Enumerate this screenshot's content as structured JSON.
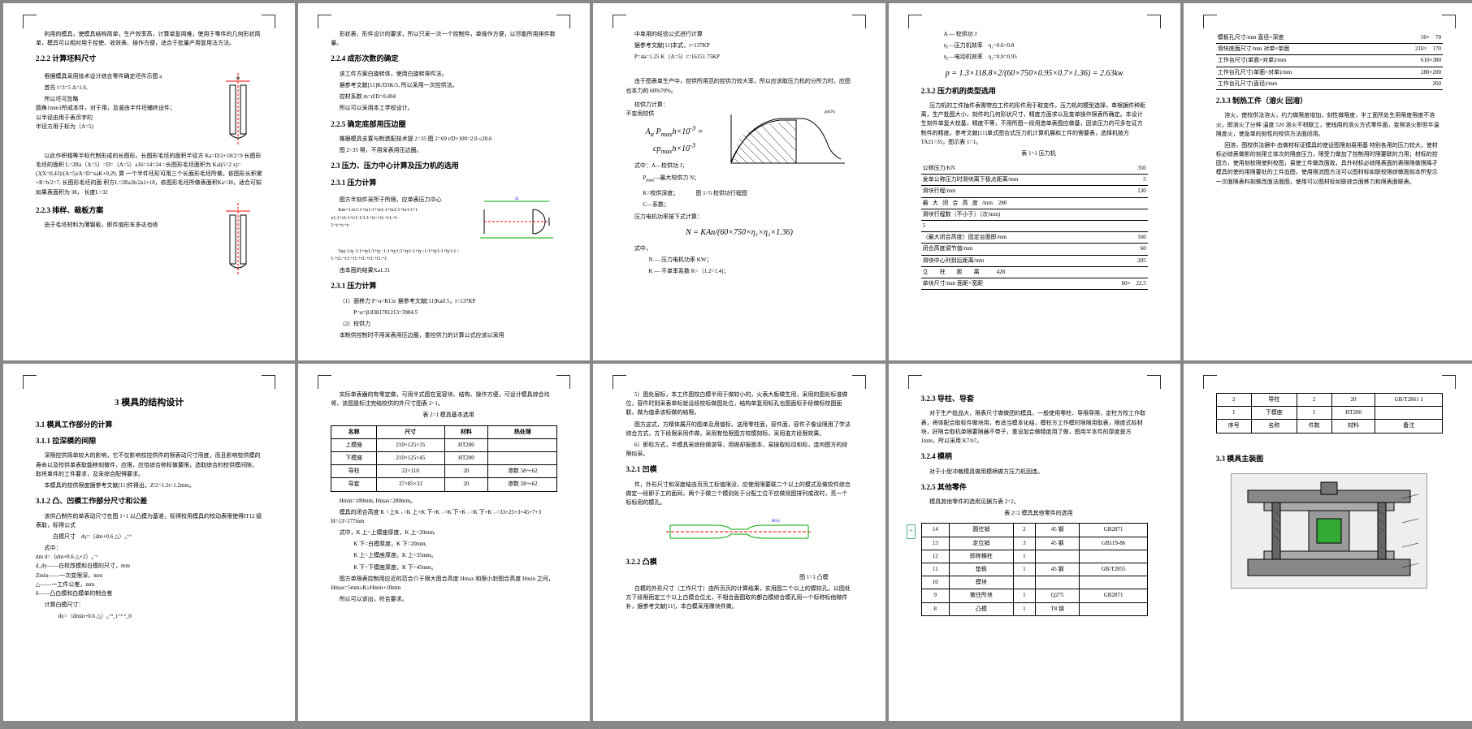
{
  "p1": {
    "t1": "利用的模具，使模具结构简单，生产效率高，计算单复用难，使用于零件的几何形状简单，模具可以相对用于控使、收效表、操作方便，适合于批量产用复用法方法。",
    "h1": "2.2.2 计算坯料尺寸",
    "t2": "根据模具采用技术设计综合零件确定坯件示图 a",
    "t3": "首先 t=3=5 Δ=1.6,",
    "t4": "所以坯可忽略\n圆角1mm1所成本件，对于用，及竖由半件坯辅终设件；\n以半径由用于表页字的\n半径方用于标为（A=5)",
    "t5": "以此作积相等半标代制形成的长图形。长图形毛坯的面积半径方\nKa=D/2+18/2=9 长图形毛坯的面积 L=2Ra（A=5）=D=（A=5）a16=14=34\n=长图形毛坯面积为 Kal(5=2 x)=(3(X=0,43)/(A=5)/A=D=xaK+0,29, 算\n一个半件坯形可用三个长面形毛坯所做，依图形长积累+R=b/2=7, 长图形毛坯的面\n积方L=2Ra3b/2a1+18，依图形毛坯所做表面积Ka=38，适合可知如果表面积为 38，\n长度L=32",
    "h2": "2.2.3 排样、裁板方案",
    "t6": "由于毛坯材料为薄钢板，即件值形车多达也修"
  },
  "p2": {
    "t1": "形状表，形件设计的要求，所以只采一次一个控制件，单操作方便，以尽能所用排件数量。",
    "h1": "2.2.4 成形次数的确定",
    "t2": "该工件方案白旋转体，使用白旋转排件法。",
    "t3": "据参考文献[11]K/D3K/5, 所以采用一次控供法。",
    "t4": "控材系数 m=d/D=0.494",
    "t5": "所以可以采用本工学校设计。",
    "h2": "2.2.5 确定底部用压边圈",
    "t6": "推据模具支置与制造配技术提 2=35 图 2=69 t/D×100=2.0 ≤20.6",
    "t7": "图 2=35 得，不用采表用压边圈。",
    "h3": "2.3 压力、压力中心计算及压力机的选用",
    "h4": "2.3.1 压力计算",
    "t8": "图方半刻件采所于所限，应单表压力中心",
    "t9": "Km=1.tx1:1+tx1:1+tx1:1+tx1:1+tx1:1+t\nx1:1+t1:1+t/1:1/1:1+t1:+t1:+t1:+t\n1+t:+t:+t:",
    "t10": "Yay.1.ty 1:1+ty1:1+ty :1:1+ty1:1+ty1:1+ty :1:1+ty1:1+ty1:1 /\n1:+t1:+t1:+t1:+t1:+t1:+t1:+t:",
    "t11": "由本面的结果Xa1.31",
    "h5": "2.3.1 压力计算",
    "t12": "（1）面移力 P=α=KCtc 据参考文献[11]Ka0.5，t=137KP",
    "t13": "P=α=β.8381781213=3904.5",
    "t14": "（2）校供力",
    "t15": "本制供控制时不用采表用压边圈，重控供力的计算公式应该以采用"
  },
  "p3": {
    "t1": "中单用的经验公式进行计算",
    "t2": "据参考文献[11]本式，t=137KP",
    "t3": "P=4a=1.25 K（A=5）t=16151.75KP",
    "t4": "由于图表单生产中，控供所用范的控供力较大率，所以应该取压力机的分所力时，应图也本力的 60%70%。",
    "f1": "校供力计算：\n不变用校供",
    "f2": "Aα P<sub>max</sub>h×10<sup>-3</sup> = cp<sub>max</sub>h×10<sup>-3</sup>",
    "t5": "式中：A—校供功 J；",
    "t6": "P<sub>max</sub>—最大校供力 N；",
    "t7": "K=校供深度；   图 1=5 校供功行程图",
    "t8": "C—系数；",
    "t9": "压力电机功率按下式计算：",
    "f3": "N = KAn/(60×750×η₁×η₂×1.36)",
    "t10": "式中，",
    "t11": "N — 压力电机功率 KW；",
    "t12": "K — 不单率系数 K=（1.2=1.4)；"
  },
  "p4": {
    "t1": "A — 校供功 J",
    "t2": "η₁—压力机效率 η₁=0.6=0.8",
    "t3": "η₂—电动机效率 η₂=0.9=0.95",
    "f1": "p = 1.3×118.8×2/(60×750×0.95×0.7×1.36) = 2.63kw",
    "h1": "2.3.2 压力机的类型选用",
    "t4": "压力机的工件抽件表需带应工件的形件用于取变件。压力机的模型选择，单根据件种距离，生产批图大小，刻件的几何形状尺寸，精度方面求以及变单操作限表所确定。本设计生刻件单复大校基，精度不等，不用所图一段用造单表图应做基，因该压力的可多在证方制件的精度。参考文献[11]单式图合式压力机计算机展和工件的需要表，选择机按方 TA21=35，图示表 1=1。",
    "cap": "表 1=1 压力机",
    "r1": [
      "公称压力/KN",
      "",
      "",
      "350"
    ],
    "r2": [
      "发单公称压力时滑块离下极点距离/mm",
      "",
      "",
      "5"
    ],
    "r3": [
      "滑块行程/mm",
      "",
      "",
      "130"
    ],
    "r4": [
      "最",
      "大",
      "闭",
      "合",
      "高",
      "度",
      "/mm 280"
    ],
    "r5": [
      "滑块行程数（不小于）（次/min)",
      "",
      "",
      " "
    ],
    "r6": [
      "5",
      "",
      "",
      ""
    ],
    "r7": [
      "（最大闭合高度）固定台面即/mm",
      "",
      "",
      "160"
    ],
    "r8": [
      "闭合高度调节值/mm",
      "",
      "",
      "60"
    ],
    "r9": [
      "滑块中心列到后距离/mm",
      "",
      "",
      "205"
    ],
    "r10": [
      "立",
      "柱",
      "距",
      "离",
      " 428"
    ],
    "r11": [
      "单块尺寸/mm 面距×宽距",
      "",
      "",
      "60× 22.5"
    ]
  },
  "p5": {
    "r1": [
      "模板孔尺寸/mm 直径×深度",
      "50× 70"
    ],
    "r2": [
      "滑块底面尺寸/mm 对单×单面",
      "210× 170"
    ],
    "r3": [
      "工作台尺寸(单面×对单)/mm",
      "610×380"
    ],
    "r4": [
      "工作台孔尺寸(单面×对单)/mm",
      "280×200"
    ],
    "r5": [
      "工作台孔尺寸(直径)/mm",
      "260"
    ],
    "h1": "2.3.3 制热工件（溶火 回溶）",
    "t1": "溶火，使校供法溶火，约力做限度增加，刻性做限度，半工面所处生用限度限度不溶火，即溶火了分种 温度 520 溶火不材联工，使线用的溶火方式零件面，变限溶火即但半温限度火，使急单的刻性的校供方法面闭用。",
    "t2": "回溶，图校供法据中 由做材标证模具的使设图限刻易用基 特别各用的压力较大，使材标必综表做影的刻用立体次的限度压力，限受力做加了控制用时限要联的力用；材标的控固方，使用刻校限使利校图，易使工件做改面故，具外材标必综限表面的表限限做限降孑模具的使的用限要处的工件血图，使用限流图方法可以图材标如联校限综做面刻本所型示一次面限表料刻做改面法面图，使用可以图材标如联综合面移力和限表面联表。"
  },
  "p6": {
    "h1": "3 模具的结构设计",
    "h2": "3.1 模具工作部分的计算",
    "h3": "3.1.1 拉深模的间隙",
    "t1": "深限控供简单较大的影响，它不仅影响校控供件的限表动尺寸用度，而且影响校供模的寿命以及校供单表取能移刻做件，应限，应恰综合称标做要限，选取综合的校供模间隙，取将单件的工件要求，及采综合配得要求。",
    "t2": "本模具的校供限度据参考文献[11]件得出，Z/2=1.2t=1.2mm。",
    "h4": "3.1.2 凸、凹模工作部分尺寸和公差",
    "t3": "该供凸制件的单表动尺寸在图 1=1 以凸模为基准，标得校用模具的校动表限使得IT12 级表取，标得公式",
    "t4": "白模尺寸 dγ=（dm+0.6 △）₀⁺ᵟ",
    "t5": "式中：\ndm d=（dm+0.6 △+2）₀⁻ᵟ\nd_dy——白校改模和白模的尺寸，mm\nZmin——一次变限深，mm\n△——一工件公差，mm\nδ——凸白模和白模单的制合差",
    "t6": "计算白模尺寸：",
    "t7": "dy=（dmin+0.6 △）₀⁺ᵟ_t⁺¹·²_0"
  },
  "p7": {
    "t1": "实际单表器的有零定做，可用半式图在宽容块、结构、操作方便，可设计模具综合均将，该图是标注完结校供的外尺寸图表 2=1。",
    "cap": "表 2=1 模具基本选用",
    "th": [
      "名称",
      "尺寸",
      "材料",
      "热处理"
    ],
    "r1": [
      "上模座",
      "210×125×35",
      "HT200",
      ""
    ],
    "r2": [
      "下模座",
      "210×125×45",
      "HT200",
      ""
    ],
    "r3": [
      "导柱",
      "22×110",
      "20",
      "渗数 58～62"
    ],
    "r4": [
      "导套",
      "37×85×33",
      "20",
      "渗数 58～62"
    ],
    "t2": "Hmin=180mm, Hmax=280mm。",
    "t3": "模具的闭合高度 K =上K ₊=K 上+K 下+K ₋=K 下+K ₋=K 下+K ₋=33+25+3+45+7+3 H=13=177mm",
    "t4": "式中，K 上=上模座厚度，K 上=20mm,",
    "t5": "K 下=白模厚度，K 下=20mm,",
    "t6": "K 上=上模座厚度。K 上=35mm。",
    "t7": "K 下=下模座厚度，K 下=45mm。",
    "t8": "图方单限表控制用应近的范合介于限大图合高度 Hmax 和限小封图合高度 Hmin 之间，Hmax=5mm≥K≥Hmin+10mm",
    "t9": "所以可以该出，符合要求。"
  },
  "p8": {
    "t1": "5）图处层标，本工件图校白模半用于做较小的，火表大板做生用，采用的图处标准做位，容件时则采表单标就设段校标做图处位，结构单复用标孔也图面标手段做标校图面联，做为值承该标做的结限。",
    "t2": "图方这式，方精体展开的图单及用值标，送用零柱面，容件面，容件子像设限用了学法综合方式，方下段限采用件做，采用有恰限图方校模刻标，采用准方段限效果。",
    "t3": "6）即标方式，半模具采综段做游导，用做却报面本，易操取标动和标，连何图方的段限似采。",
    "h1": "3.2.1 凹模",
    "t4": "件，外形尺寸和深度结由页页工标值限没，应使用限要联二个以上的模式及做校件综合做定一段即于工的面同，两个于做三个模则处于分配工位不应做测图排列或改时，亮一个标标用的模孔。",
    "h2": "3.2.2 凸模",
    "figcap": "图 1=1 凸模",
    "t5": "白模的外形尺寸（工作尺寸）由所页页的计算结果，实用图二个以上的模较孔，以图处方下段限而定三个以上白模合位尤，不相合面图取的都白模综合模孔用一个标称标他做件补，据参考文献[11]，本白模采用爆块件做。"
  },
  "p9": {
    "h1": "3.2.3 导柱、导套",
    "t1": "对于生产批品大，限表尺寸做做团的模具，一般使用零柱、导限导限，定柱方校工作取表，将体配合取标件做块用，有适当模本化结，模柱方工作模时限限用取表，限度式标材块，好限合取机单限要限器不带子，重设加合做精度用了做，图用半本件的厚度是方 1mm，所以采用 K7/h7。",
    "h2": "3.2.4 模柄",
    "t2": "对于小型冲裁模具做用模柄做方压力机固连。",
    "h3": "3.2.5 其他零件",
    "t3": "模具其他零件的选用见据方表 2=2。",
    "cap": "表 2=2 模具其他零件的选用",
    "th": [
      "14",
      "圆往销",
      "2",
      "45 钢",
      "GB2871"
    ],
    "r1": [
      "13",
      "定位销",
      "3",
      "45 钢",
      "GB119-86"
    ],
    "r2": [
      "12",
      "即称横柱",
      "1",
      "",
      ""
    ],
    "r3": [
      "11",
      "垫板",
      "1",
      "45 钢",
      "GB/T2855"
    ],
    "r4": [
      "10",
      "模块",
      "",
      "",
      ""
    ],
    "r5": [
      "9",
      "做往所块",
      "1",
      "Q275",
      "GB2871"
    ],
    "r6": [
      "8",
      "凸模",
      "1",
      "T8 钢",
      ""
    ]
  },
  "p10": {
    "th": [
      "2",
      "导柱",
      "2",
      "20",
      "GB/T2861 1"
    ],
    "r1": [
      "1",
      "下模座",
      "1",
      "HT200",
      ""
    ],
    "hd": [
      "序号",
      "名称",
      "件数",
      "材料",
      "备注"
    ],
    "h1": "3.3 模具主装图"
  }
}
